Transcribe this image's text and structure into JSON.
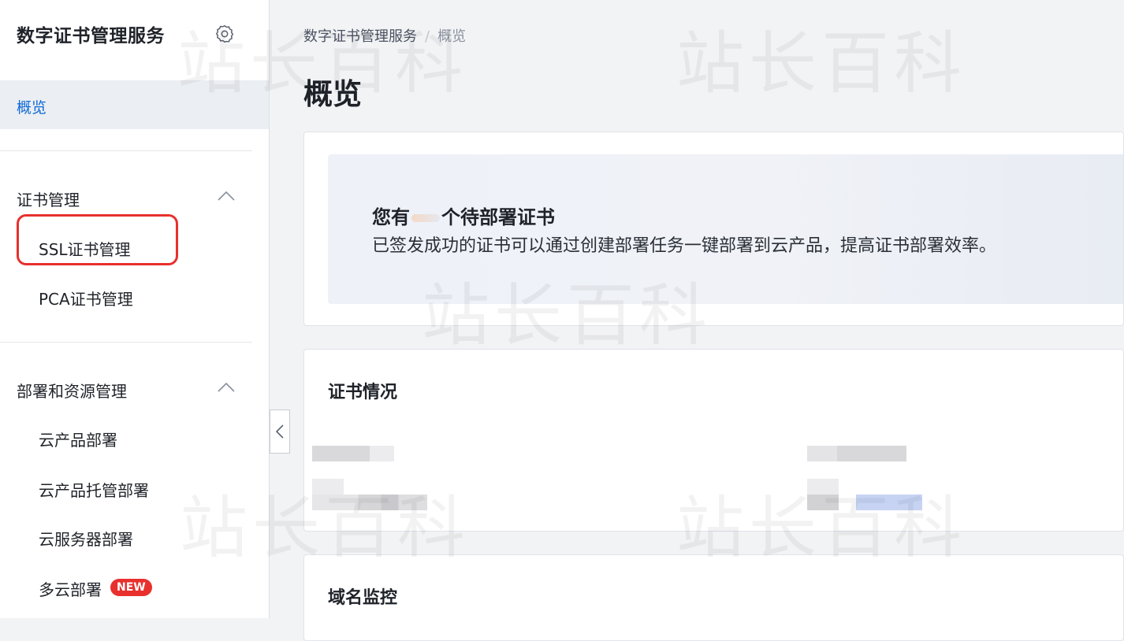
{
  "sidebar": {
    "title": "数字证书管理服务",
    "overview_label": "概览",
    "groups": [
      {
        "label": "证书管理",
        "items": [
          {
            "label": "SSL证书管理"
          },
          {
            "label": "PCA证书管理"
          }
        ]
      },
      {
        "label": "部署和资源管理",
        "items": [
          {
            "label": "云产品部署"
          },
          {
            "label": "云产品托管部署"
          },
          {
            "label": "云服务器部署"
          },
          {
            "label": "多云部署",
            "badge": "NEW"
          }
        ]
      }
    ]
  },
  "breadcrumb": {
    "root": "数字证书管理服务",
    "separator": "/",
    "current": "概览"
  },
  "page": {
    "title": "概览"
  },
  "banner": {
    "title_prefix": "您有",
    "title_suffix": "个待部署证书",
    "description": "已签发成功的证书可以通过创建部署任务一键部署到云产品，提高证书部署效率。"
  },
  "sections": {
    "cert_status_title": "证书情况",
    "domain_monitor_title": "域名监控"
  },
  "watermark": "站长百科",
  "colors": {
    "accent": "#0f6ad9",
    "highlight_red": "#e8302d",
    "sidebar_active_bg": "#ebeef2"
  }
}
